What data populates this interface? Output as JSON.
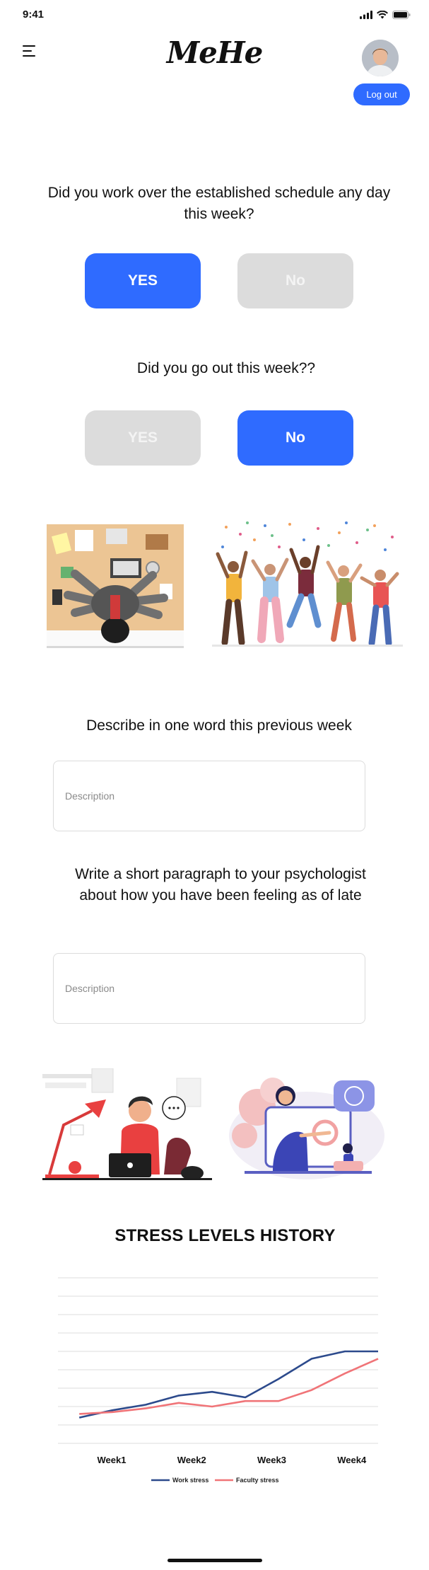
{
  "status_bar": {
    "time": "9:41"
  },
  "header": {
    "logo": "MeHe",
    "logout_label": "Log out"
  },
  "questions": [
    {
      "text": "Did you work over the established schedule any day this week?",
      "yes_label": "YES",
      "no_label": "No",
      "selected": "yes"
    },
    {
      "text": "Did you go out this week??",
      "yes_label": "YES",
      "no_label": "No",
      "selected": "no"
    }
  ],
  "describe": {
    "question": "Describe in one word this previous week",
    "placeholder": "Description"
  },
  "paragraph": {
    "question": "Write a short paragraph to your psychologist about how you have been feeling as of late",
    "placeholder": "Description"
  },
  "colors": {
    "accent": "#2f6bff",
    "inactive": "#dcdcdc",
    "work_stress": "#2c4a8c",
    "faculty_stress": "#f07478"
  },
  "chart_data": {
    "type": "line",
    "title": "STRESS LEVELS HISTORY",
    "categories": [
      "Week1",
      "Week2",
      "Week3",
      "Week4"
    ],
    "x": [
      0,
      0.5,
      1,
      1.5,
      2,
      2.5,
      3,
      3.5,
      4,
      4.5,
      5,
      5.5,
      6
    ],
    "series": [
      {
        "name": "Work stress",
        "color": "#2c4a8c",
        "values": [
          1.4,
          1.8,
          2.1,
          2.6,
          2.8,
          2.5,
          3.5,
          4.6,
          5.0,
          5.0
        ]
      },
      {
        "name": "Faculty stress",
        "color": "#f07478",
        "values": [
          1.6,
          1.7,
          1.9,
          2.2,
          2.0,
          2.3,
          2.3,
          2.9,
          3.8,
          4.6
        ]
      }
    ],
    "ylim": [
      0,
      9
    ],
    "grid": true,
    "legend": "bottom"
  }
}
